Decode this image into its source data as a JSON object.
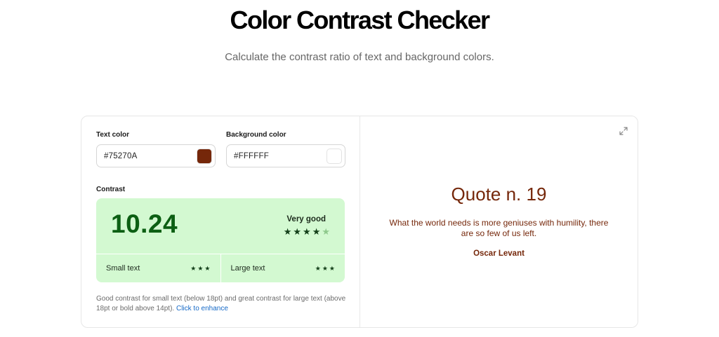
{
  "header": {
    "title": "Color Contrast Checker",
    "subtitle": "Calculate the contrast ratio of text and background colors."
  },
  "colors": {
    "text_label": "Text color",
    "text_value": "#75270A",
    "background_label": "Background color",
    "background_value": "#FFFFFF",
    "accent_green_bg": "#d3f9d1",
    "ratio_green": "#0c5f13"
  },
  "contrast": {
    "label": "Contrast",
    "ratio": "10.24",
    "rating": "Very good",
    "rating_stars": 4,
    "rating_stars_max": 5,
    "small_text": {
      "label": "Small text",
      "stars": 3
    },
    "large_text": {
      "label": "Large text",
      "stars": 3
    }
  },
  "note": {
    "text": "Good contrast for small text (below 18pt) and great contrast for large text (above 18pt or bold above 14pt).",
    "link": "Click to enhance"
  },
  "preview": {
    "expand_icon": "expand-icon",
    "quote_title": "Quote n. 19",
    "quote_text": "What the world needs is more geniuses with humility, there are so few of us left.",
    "quote_author": "Oscar Levant"
  }
}
